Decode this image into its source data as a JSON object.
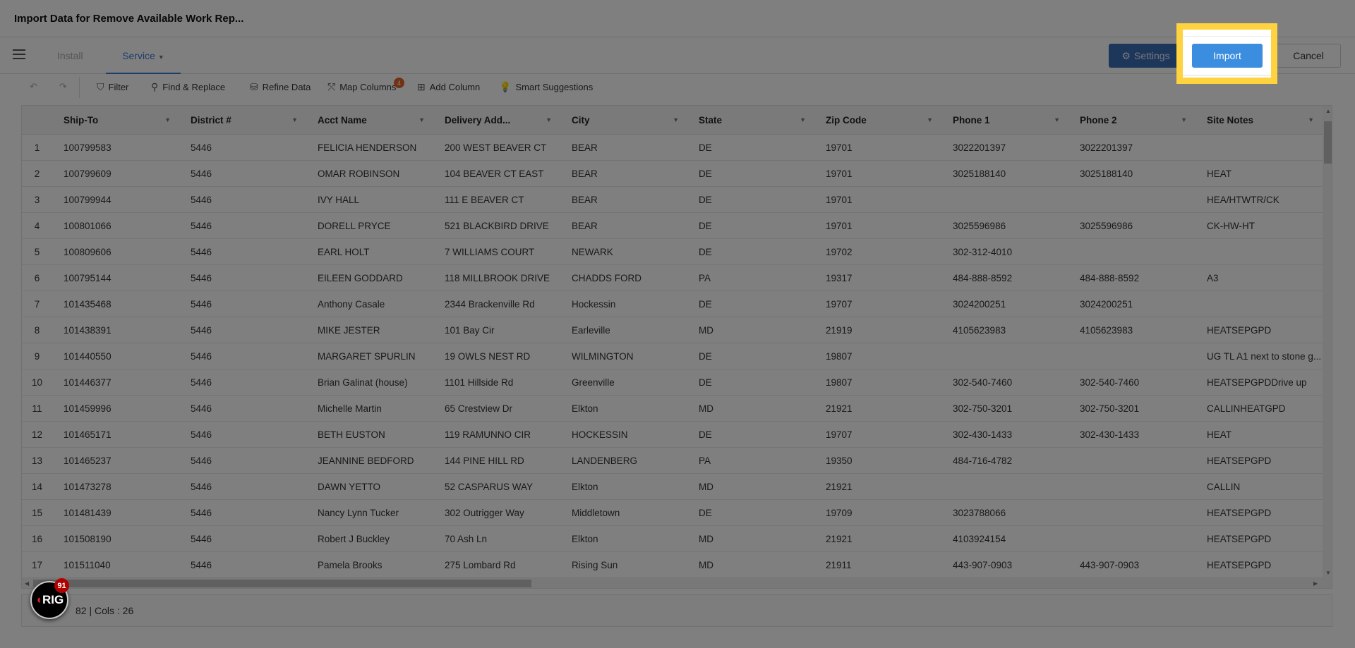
{
  "window": {
    "title": "Import Data for Remove Available Work Rep..."
  },
  "tabs": [
    {
      "label": "Install",
      "active": false
    },
    {
      "label": "Service",
      "active": true
    }
  ],
  "header_buttons": {
    "settings": "Settings",
    "import": "Import",
    "cancel": "Cancel"
  },
  "toolbar": {
    "undo_icon": "undo-icon",
    "redo_icon": "redo-icon",
    "filter": "Filter",
    "find_replace": "Find & Replace",
    "refine_data": "Refine Data",
    "map_columns": "Map Columns",
    "map_columns_badge": "4",
    "add_column": "Add Column",
    "smart_suggestions": "Smart Suggestions"
  },
  "grid": {
    "columns": [
      "Ship-To",
      "District #",
      "Acct Name",
      "Delivery Add...",
      "City",
      "State",
      "Zip Code",
      "Phone 1",
      "Phone 2",
      "Site Notes"
    ],
    "rows": [
      [
        "1",
        "100799583",
        "5446",
        "FELICIA HENDERSON",
        "200 WEST BEAVER CT",
        "BEAR",
        "DE",
        "19701",
        "3022201397",
        "3022201397",
        ""
      ],
      [
        "2",
        "100799609",
        "5446",
        "OMAR ROBINSON",
        "104 BEAVER CT EAST",
        "BEAR",
        "DE",
        "19701",
        "3025188140",
        "3025188140",
        "HEAT"
      ],
      [
        "3",
        "100799944",
        "5446",
        "IVY HALL",
        "111 E BEAVER CT",
        "BEAR",
        "DE",
        "19701",
        "",
        "",
        "HEA/HTWTR/CK"
      ],
      [
        "4",
        "100801066",
        "5446",
        "DORELL PRYCE",
        "521 BLACKBIRD DRIVE",
        "BEAR",
        "DE",
        "19701",
        "3025596986",
        "3025596986",
        "CK-HW-HT"
      ],
      [
        "5",
        "100809606",
        "5446",
        "EARL HOLT",
        "7 WILLIAMS COURT",
        "NEWARK",
        "DE",
        "19702",
        "302-312-4010",
        "",
        ""
      ],
      [
        "6",
        "100795144",
        "5446",
        "EILEEN GODDARD",
        "118 MILLBROOK DRIVE",
        "CHADDS FORD",
        "PA",
        "19317",
        "484-888-8592",
        "484-888-8592",
        "A3"
      ],
      [
        "7",
        "101435468",
        "5446",
        "Anthony Casale",
        "2344 Brackenville Rd",
        "Hockessin",
        "DE",
        "19707",
        "3024200251",
        "3024200251",
        ""
      ],
      [
        "8",
        "101438391",
        "5446",
        "MIKE JESTER",
        "101 Bay Cir",
        "Earleville",
        "MD",
        "21919",
        "4105623983",
        "4105623983",
        "HEATSEPGPD"
      ],
      [
        "9",
        "101440550",
        "5446",
        "MARGARET SPURLIN",
        "19 OWLS NEST RD",
        "WILMINGTON",
        "DE",
        "19807",
        "",
        "",
        "UG TL A1 next to stone g..."
      ],
      [
        "10",
        "101446377",
        "5446",
        "Brian Galinat (house)",
        "1101 Hillside Rd",
        "Greenville",
        "DE",
        "19807",
        "302-540-7460",
        "302-540-7460",
        "HEATSEPGPDDrive up"
      ],
      [
        "11",
        "101459996",
        "5446",
        "Michelle Martin",
        "65 Crestview Dr",
        "Elkton",
        "MD",
        "21921",
        "302-750-3201",
        "302-750-3201",
        "CALLINHEATGPD"
      ],
      [
        "12",
        "101465171",
        "5446",
        "BETH EUSTON",
        "119 RAMUNNO CIR",
        "HOCKESSIN",
        "DE",
        "19707",
        "302-430-1433",
        "302-430-1433",
        "HEAT"
      ],
      [
        "13",
        "101465237",
        "5446",
        "JEANNINE BEDFORD",
        "144 PINE HILL RD",
        "LANDENBERG",
        "PA",
        "19350",
        "484-716-4782",
        "",
        "HEATSEPGPD"
      ],
      [
        "14",
        "101473278",
        "5446",
        "DAWN YETTO",
        "52 CASPARUS WAY",
        "Elkton",
        "MD",
        "21921",
        "",
        "",
        "CALLIN"
      ],
      [
        "15",
        "101481439",
        "5446",
        "Nancy Lynn Tucker",
        "302 Outrigger Way",
        "Middletown",
        "DE",
        "19709",
        "3023788066",
        "",
        "HEATSEPGPD"
      ],
      [
        "16",
        "101508190",
        "5446",
        "Robert J Buckley",
        "70 Ash Ln",
        "Elkton",
        "MD",
        "21921",
        "4103924154",
        "",
        "HEATSEPGPD"
      ],
      [
        "17",
        "101511040",
        "5446",
        "Pamela Brooks",
        "275 Lombard Rd",
        "Rising Sun",
        "MD",
        "21911",
        "443-907-0903",
        "443-907-0903",
        "HEATSEPGPD"
      ]
    ]
  },
  "status": {
    "text": "82 | Cols : 26"
  },
  "floating_logo": {
    "text": "RIG",
    "badge": "91"
  },
  "colors": {
    "highlight": "#ffd23f",
    "import_button": "#3a8ddf",
    "settings_button": "#3b6fb6",
    "badge": "#e0622a"
  }
}
